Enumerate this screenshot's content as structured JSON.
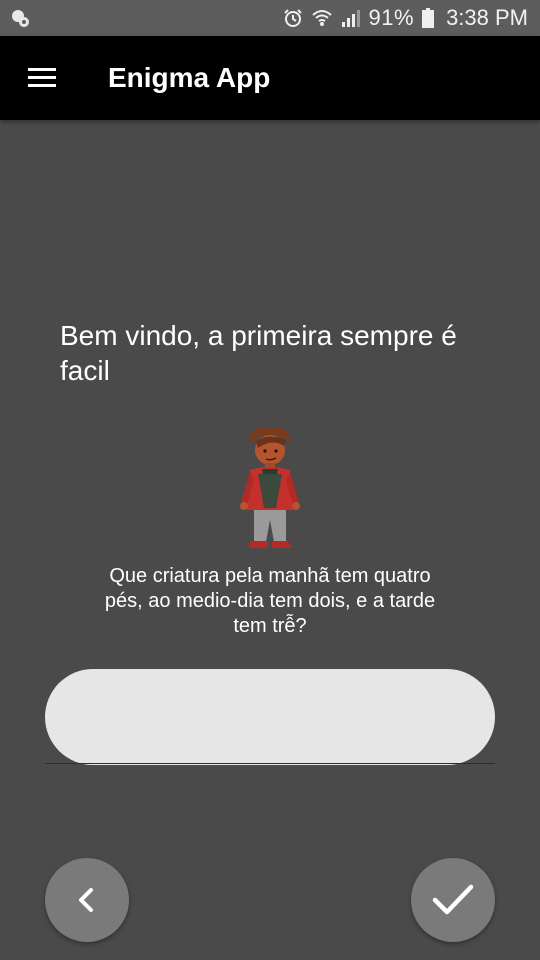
{
  "status_bar": {
    "battery": "91%",
    "time": "3:38 PM",
    "icons": [
      "notification-icon",
      "alarm-icon",
      "wifi-icon",
      "signal-icon",
      "battery-icon"
    ]
  },
  "app_bar": {
    "title": "Enigma App",
    "menu_icon": "hamburger-menu-icon"
  },
  "content": {
    "heading": "Bem vindo, a primeira sempre é facil",
    "question": "Que criatura pela manhã tem quatro pés, ao medio-dia tem dois, e a tarde tem trễ?",
    "character_icon": "character-illustration",
    "answer_input": {
      "value": "",
      "placeholder": ""
    }
  },
  "actions": {
    "back_icon": "chevron-left-icon",
    "confirm_icon": "check-icon"
  },
  "colors": {
    "background": "#4a4a4a",
    "status_bar": "#5d5d5d",
    "app_bar": "#000000",
    "input": "#e6e6e6",
    "fab": "#7a7a7a"
  }
}
